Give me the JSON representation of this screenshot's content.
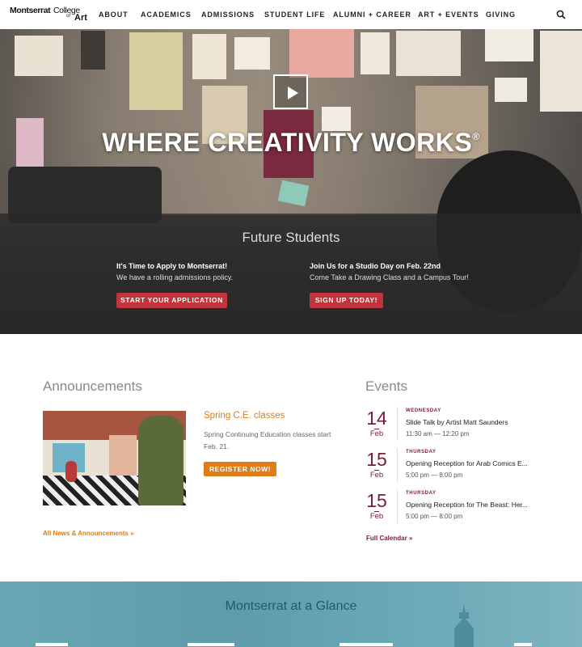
{
  "header": {
    "logo": {
      "line1": "Montserrat",
      "line2": "College",
      "line3": "of",
      "line4": "Art"
    },
    "nav": [
      "ABOUT",
      "ACADEMICS",
      "ADMISSIONS",
      "STUDENT LIFE",
      "ALUMNI + CAREER",
      "ART + EVENTS",
      "GIVING"
    ],
    "search_icon": "search-icon"
  },
  "hero": {
    "tagline": "WHERE CREATIVITY WORKS",
    "tagline_mark": "®",
    "play_icon": "play-icon",
    "section_title": "Future Students",
    "promos": [
      {
        "heading": "It's Time to Apply to Montserrat!",
        "text": "We have a rolling admissions policy.",
        "button": "START YOUR APPLICATION"
      },
      {
        "heading": "Join Us for a Studio Day on Feb. 22nd",
        "text": "Come Take a Drawing Class and a Campus Tour!",
        "button": "SIGN UP TODAY!"
      }
    ]
  },
  "announcements": {
    "heading": "Announcements",
    "item": {
      "title": "Spring C.E. classes",
      "description": "Spring Continuing Education classes start Feb. 21.",
      "button": "REGISTER NOW!"
    },
    "all_link": "All News & Announcements »"
  },
  "events": {
    "heading": "Events",
    "items": [
      {
        "day": "14",
        "month": "Feb",
        "weekday": "WEDNESDAY",
        "title": "Slide Talk by Artist Matt Saunders",
        "time": "11:30 am — 12:20 pm"
      },
      {
        "day": "15",
        "month": "Feb",
        "weekday": "THURSDAY",
        "title": "Opening Reception for Arab Comics E...",
        "time": "5:00 pm — 8:00 pm"
      },
      {
        "day": "15",
        "month": "Feb",
        "weekday": "THURSDAY",
        "title": "Opening Reception for The Beast: Her...",
        "time": "5:00 pm — 8:00 pm"
      }
    ],
    "calendar_link": "Full Calendar »"
  },
  "glance": {
    "heading": "Montserrat at a Glance"
  },
  "colors": {
    "accent_red": "#c0343b",
    "accent_orange": "#e07b16",
    "event_maroon": "#7b1c34",
    "glance_teal": "#5e9cab"
  }
}
